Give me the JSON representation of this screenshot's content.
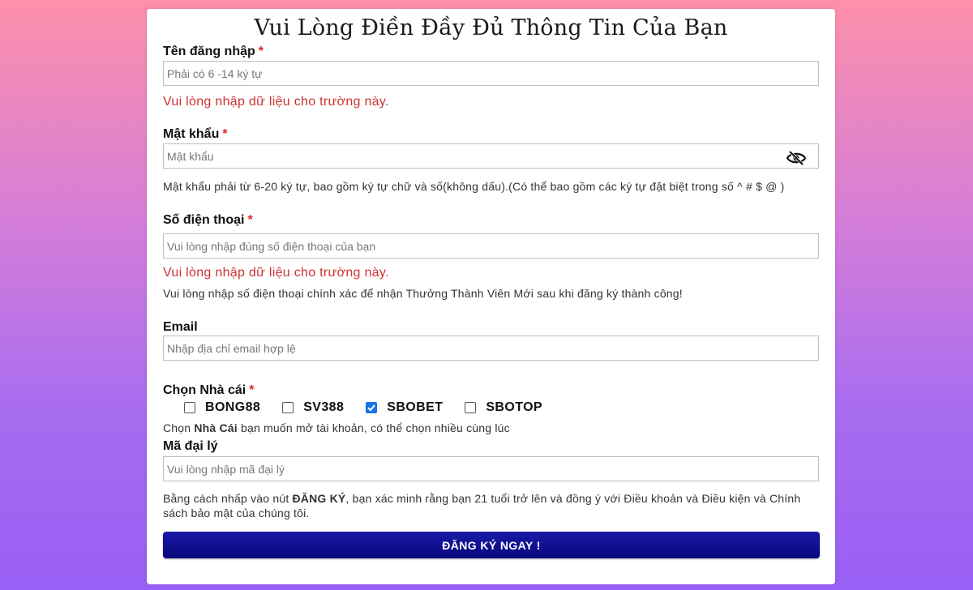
{
  "form": {
    "title": "Vui Lòng Điền Đầy Đủ Thông Tin Của Bạn",
    "required_mark": "*",
    "username": {
      "label": "Tên đăng nhập",
      "placeholder": "Phải có 6 -14 ký tự",
      "error": "Vui lòng nhập dữ liệu cho trường này."
    },
    "password": {
      "label": "Mật khẩu",
      "placeholder": "Mật khẩu",
      "help": "Mật khẩu phải từ 6-20 ký tự, bao gồm ký tự chữ và số(không dấu).(Có thể bao gồm các ký tự đặt biệt trong số ^ # $ @ )",
      "toggle_icon": "eye-slash-icon"
    },
    "phone": {
      "label": "Số điện thoại",
      "placeholder": "Vui lòng nhập đúng số điện thoại của bạn",
      "error": "Vui lòng nhập dữ liệu cho trường này.",
      "help": "Vui lòng nhập số điện thoại chính xác để nhận Thưởng Thành Viên Mới sau khi đăng ký thành công!"
    },
    "email": {
      "label": "Email",
      "placeholder": "Nhập địa chỉ email hợp lệ"
    },
    "bookmaker": {
      "label": "Chọn Nhà cái",
      "options": [
        {
          "label": "BONG88",
          "checked": false
        },
        {
          "label": "SV388",
          "checked": false
        },
        {
          "label": "SBOBET",
          "checked": true
        },
        {
          "label": "SBOTOP",
          "checked": false
        }
      ],
      "help_prefix": "Chọn ",
      "help_bold": "Nhà Cái",
      "help_suffix": " bạn muốn mở tài khoản, có thể chọn nhiều cùng lúc"
    },
    "agent_code": {
      "label": "Mã đại lý",
      "placeholder": "Vui lòng nhập mã đại lý"
    },
    "terms": {
      "prefix": "Bằng cách nhấp vào nút ",
      "bold": "ĐĂNG KÝ",
      "suffix": ", bạn xác minh rằng bạn 21 tuổi trở lên và đồng ý với Điều khoản và Điều kiện và Chính sách bảo mật của chúng tôi."
    },
    "submit_label": "ĐĂNG KÝ NGAY !"
  },
  "colors": {
    "error": "#cf3232",
    "required": "#d62828",
    "button": "#0e0e8c",
    "checkbox_checked": "#1a73e8"
  }
}
